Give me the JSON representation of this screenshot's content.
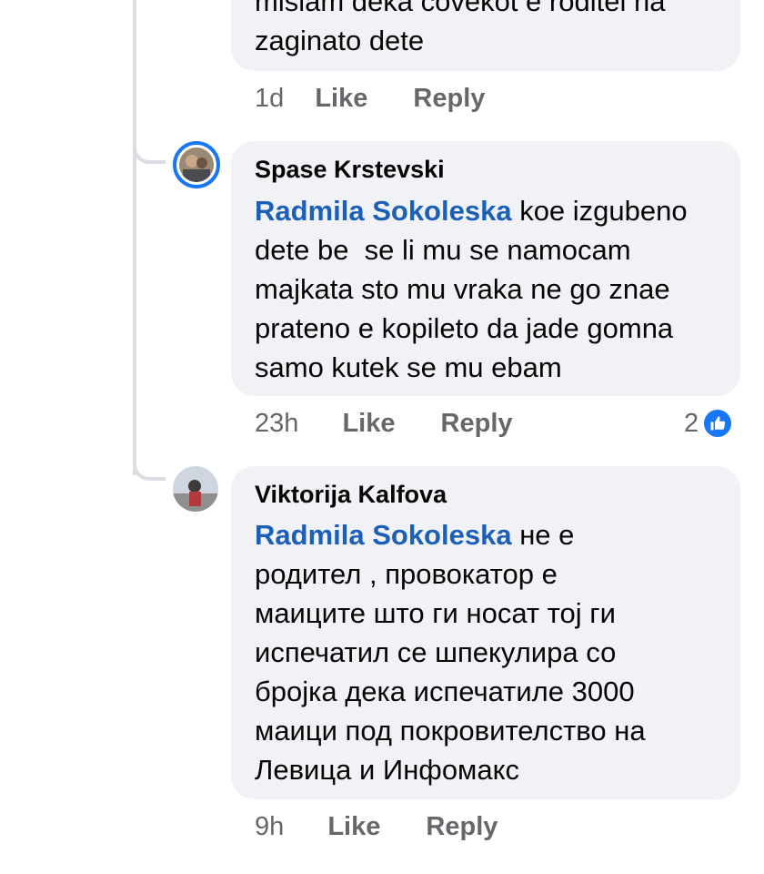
{
  "comments": [
    {
      "text_lines": [
        "misiam deka covekot e roditel na",
        "zaginato dete"
      ],
      "time": "1d",
      "like_label": "Like",
      "reply_label": "Reply"
    },
    {
      "author": "Spase Krstevski",
      "mention": "Radmila Sokoleska",
      "text_after_mention": " koe izgubeno",
      "text_lines": [
        "dete be  se li mu se namocam",
        "majkata sto mu vraka ne go znae",
        "prateno e kopileto da jade gomna",
        "samo kutek se mu ebam"
      ],
      "time": "23h",
      "like_label": "Like",
      "reply_label": "Reply",
      "reaction_count": "2",
      "reaction_icon": "thumbs-up-icon"
    },
    {
      "author": "Viktorija Kalfova",
      "mention": "Radmila Sokoleska",
      "text_after_mention": " не е",
      "text_lines": [
        "родител , провокатор е",
        "маиците што ги носат тој ги",
        "испечатил се шпекулира со",
        "бројка дека испечатиле 3000",
        "маици под покровителство на",
        "Левица и Инфомакс"
      ],
      "time": "9h",
      "like_label": "Like",
      "reply_label": "Reply"
    }
  ],
  "colors": {
    "bubble": "#f0f2f5",
    "mention": "#1b5fb6",
    "meta": "#65676b",
    "thread_line": "#dadde1",
    "like_badge": "#1877f2"
  }
}
